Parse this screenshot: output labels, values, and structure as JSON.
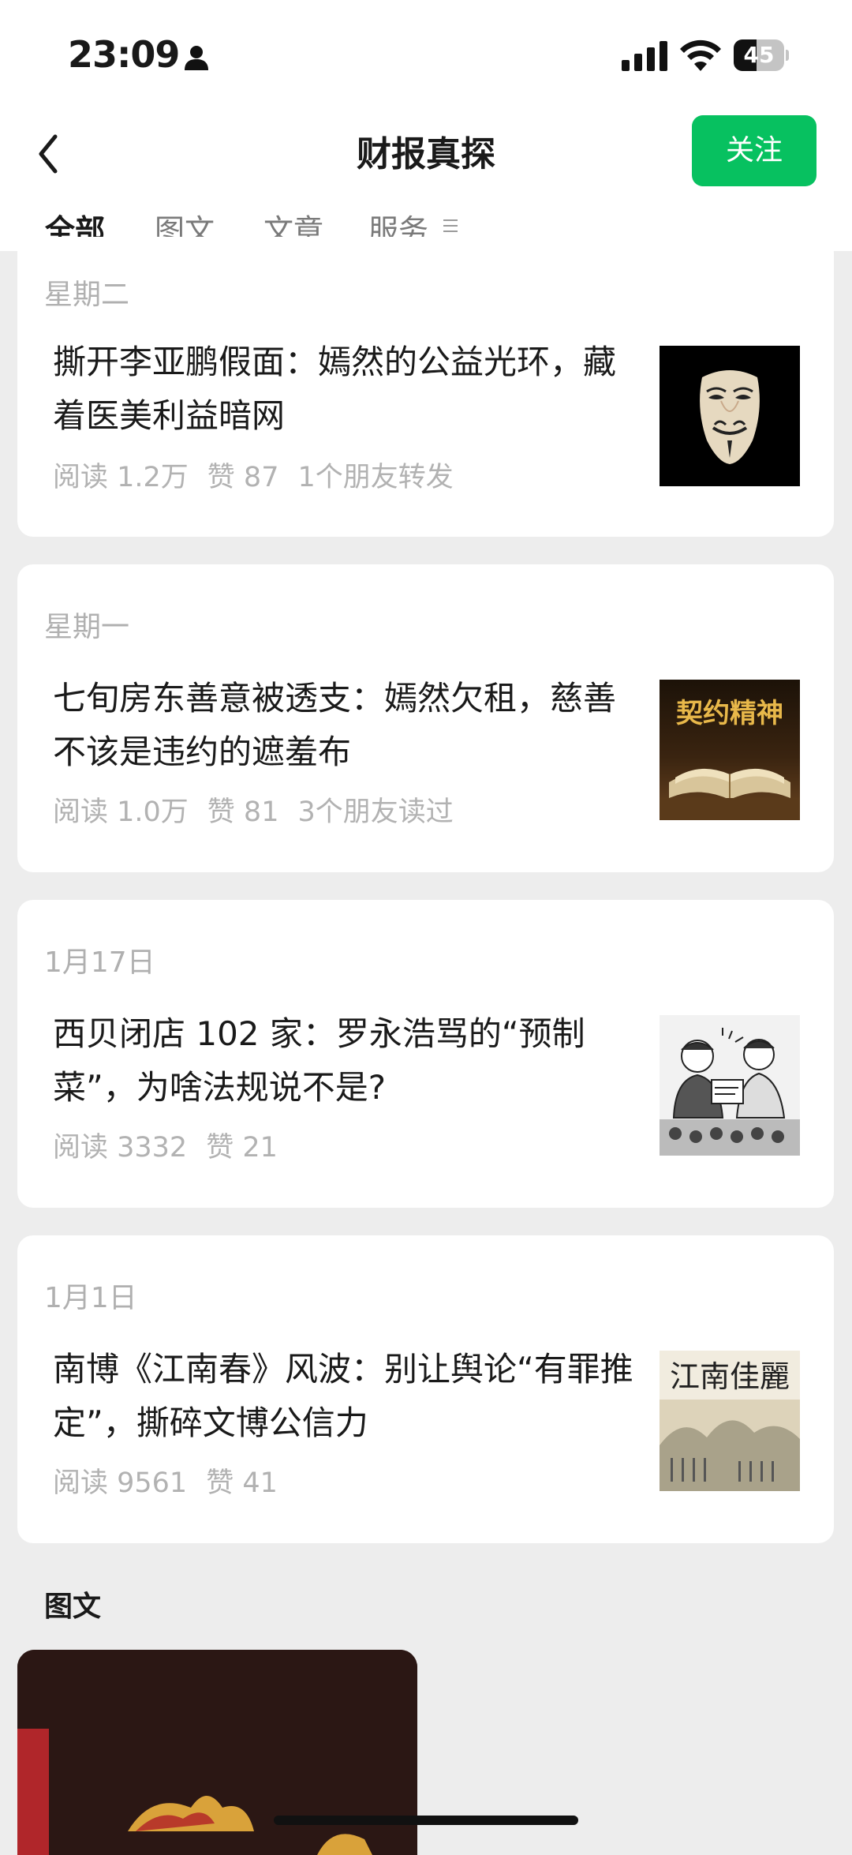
{
  "status_bar": {
    "time": "23:09",
    "battery": "45",
    "battery_level": 0.45,
    "icons": [
      "person-icon",
      "signal-icon",
      "wifi-icon",
      "battery-icon"
    ]
  },
  "header": {
    "title": "财报真探",
    "follow_label": "关注",
    "back_icon": "chevron-left-icon"
  },
  "tabs": [
    {
      "label": "全部",
      "active": true
    },
    {
      "label": "图文",
      "active": false
    },
    {
      "label": "文章",
      "active": false
    },
    {
      "label": "服务",
      "active": false
    }
  ],
  "articles": [
    {
      "date": "星期二",
      "title": "撕开李亚鹏假面：嫣然的公益光环，藏着医美利益暗网",
      "reads": "阅读 1.2万",
      "likes": "赞 87",
      "social": "1个朋友转发",
      "thumb": "mask-thumbnail"
    },
    {
      "date": "星期一",
      "title": "七旬房东善意被透支：嫣然欠租，慈善不该是违约的遮羞布",
      "reads": "阅读 1.0万",
      "likes": "赞 81",
      "social": "3个朋友读过",
      "thumb": "book-thumbnail",
      "thumb_text": "契约精神"
    },
    {
      "date": "1月17日",
      "title": "西贝闭店 102 家：罗永浩骂的“预制菜”，为啥法规说不是?",
      "reads": "阅读 3332",
      "likes": "赞 21",
      "social": "",
      "thumb": "cartoon-thumbnail"
    },
    {
      "date": "1月1日",
      "title": "南博《江南春》风波：别让舆论“有罪推定”，撕碎文博公信力",
      "reads": "阅读 9561",
      "likes": "赞 41",
      "social": "",
      "thumb": "painting-thumbnail",
      "thumb_text": "江南佳麗"
    }
  ],
  "section": {
    "label": "图文"
  },
  "colors": {
    "accent": "#07c160",
    "background": "#ededed",
    "card": "#ffffff"
  }
}
